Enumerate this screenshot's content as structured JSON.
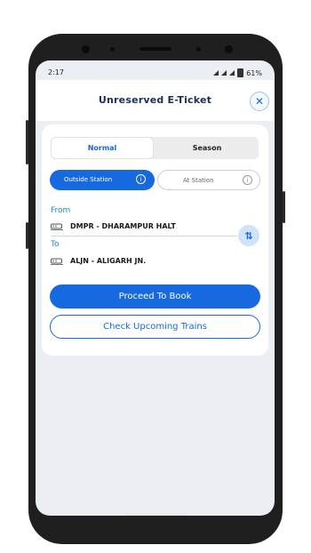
{
  "status_bar": {
    "time": "2:17",
    "battery": "61%"
  },
  "header": {
    "title": "Unreserved E-Ticket",
    "close_symbol": "✕"
  },
  "ticket_type": {
    "options": [
      "Normal",
      "Season"
    ],
    "selected": "Normal"
  },
  "location_mode": {
    "options": [
      "Outside Station",
      "At Station"
    ],
    "selected": "Outside Station",
    "info_symbol": "i"
  },
  "from": {
    "label": "From",
    "station": "DMPR - DHARAMPUR HALT"
  },
  "to": {
    "label": "To",
    "station": "ALJN - ALIGARH JN."
  },
  "swap_symbol": "⇅",
  "actions": {
    "proceed": "Proceed To Book",
    "check_trains": "Check Upcoming Trains"
  },
  "colors": {
    "primary": "#1769e0",
    "label": "#1d8ad4",
    "title": "#1a2e57",
    "background": "#ebeff3"
  }
}
